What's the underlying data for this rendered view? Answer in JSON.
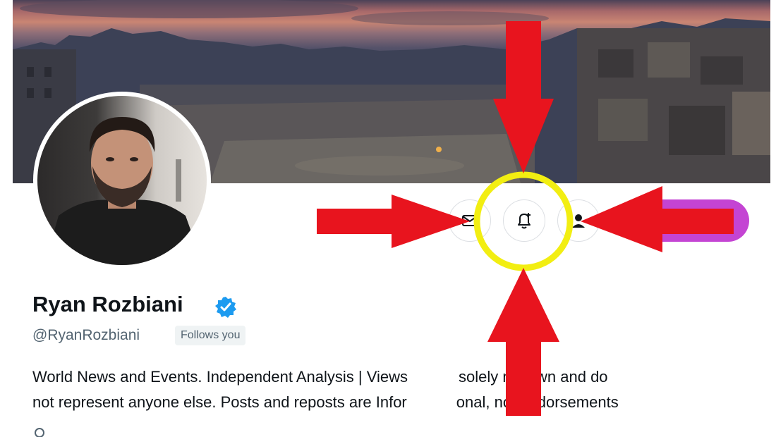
{
  "profile": {
    "display_name": "Ryan Rozbiani",
    "handle": "@RyanRozbiani",
    "follows_badge": "Follows you",
    "bio_line_1": "World News and Events. Independent Analysis | Views",
    "bio_line_1_tail": "solely my own and do",
    "bio_line_2": "not represent anyone else. Posts and reposts are Infor",
    "bio_line_2_tail": "onal, not endorsements",
    "verified": true
  },
  "actions": {
    "message_icon": "envelope-icon",
    "notify_icon": "bell-plus-icon",
    "profile_icon": "person-icon"
  },
  "colors": {
    "accent_blue": "#1d9bf0",
    "arrow_red": "#e8141e",
    "highlight_yellow": "#f2ee12",
    "follow_purple": "#c444d3"
  }
}
